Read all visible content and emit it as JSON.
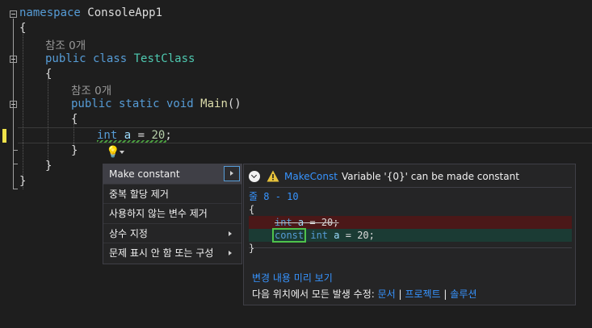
{
  "editor": {
    "codelens_class": "참조 0개",
    "codelens_method": "참조 0개",
    "lines": {
      "ns_kw": "namespace",
      "ns_name": " ConsoleApp1",
      "brace_open_1": "{",
      "class_mod": "public class",
      "class_name": "TestClass",
      "brace_open_2": "{",
      "method_mod": "public static void",
      "method_name": "Main",
      "method_paren": "()",
      "brace_open_3": "{",
      "stmt_type": "int",
      "stmt_var": "a",
      "stmt_eq": " = ",
      "stmt_num": "20",
      "stmt_semi": ";",
      "brace_close_3": "}",
      "brace_close_2": "}",
      "brace_close_1": "}"
    }
  },
  "quick_actions": {
    "lightbulb_icon": "lightbulb-icon",
    "items": [
      {
        "label": "Make constant",
        "has_submenu": true,
        "selected": true
      },
      {
        "label": "중복 할당 제거",
        "has_submenu": false
      },
      {
        "label": "사용하지 않는 변수 제거",
        "has_submenu": false
      },
      {
        "label": "상수 지정",
        "has_submenu": true
      },
      {
        "label": "문제 표시 안 함 또는 구성",
        "has_submenu": true
      }
    ]
  },
  "preview": {
    "rule_id": "MakeConst",
    "message": "Variable '{0}' can be made constant",
    "line_range": "줄 8 - 10",
    "diff": {
      "open_brace": "{",
      "removed": {
        "type": "int",
        "var": "a",
        "rest": " = 20;"
      },
      "added": {
        "const": "const",
        "type": "int",
        "var": "a",
        "rest": " = 20;"
      },
      "close_brace": "}"
    },
    "preview_changes": "변경 내용 미리 보기",
    "fix_all_label": "다음 위치에서 모든 발생 수정:",
    "fix_all_document": "문서",
    "fix_all_project": "프로젝트",
    "fix_all_solution": "솔루션",
    "separator": "|"
  },
  "colors": {
    "accent_link": "#3794ff",
    "diff_removed": "#4b1818",
    "diff_added": "#1b3b34",
    "warning": "#e8c33b"
  }
}
